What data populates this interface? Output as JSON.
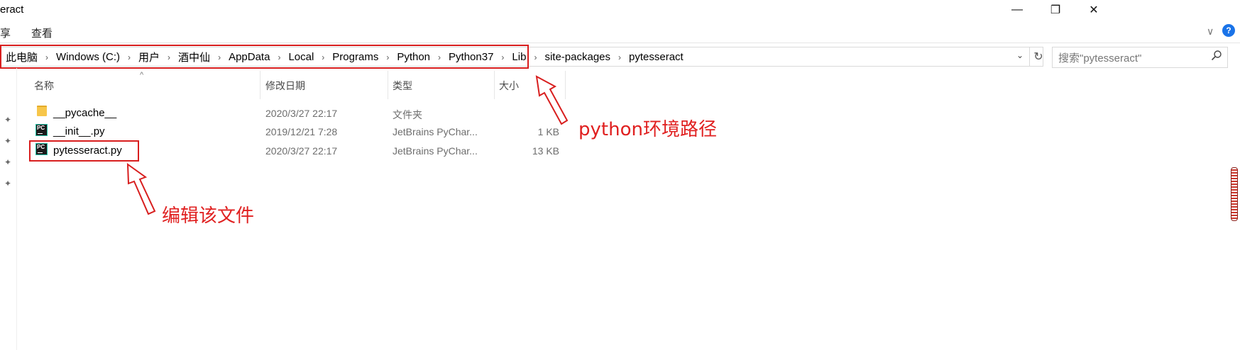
{
  "window": {
    "title": "eract",
    "controls": {
      "minimize": "—",
      "maximize": "❐",
      "close": "✕"
    }
  },
  "ribbon": {
    "tabs": [
      "享",
      "查看"
    ],
    "expand_glyph": "∨",
    "help_glyph": "?"
  },
  "address": {
    "crumbs": [
      "此电脑",
      "Windows (C:)",
      "用户",
      "酒中仙",
      "AppData",
      "Local",
      "Programs",
      "Python",
      "Python37",
      "Lib",
      "site-packages",
      "pytesseract"
    ],
    "separator": "›",
    "dropdown_glyph": "⌄",
    "refresh_glyph": "↻"
  },
  "search": {
    "placeholder": "搜索\"pytesseract\""
  },
  "columns": {
    "name": "名称",
    "date": "修改日期",
    "type": "类型",
    "size": "大小",
    "sort_glyph": "^"
  },
  "files": [
    {
      "name": "__pycache__",
      "date": "2020/3/27 22:17",
      "type": "文件夹",
      "size": "",
      "icon": "folder-icon"
    },
    {
      "name": "__init__.py",
      "date": "2019/12/21 7:28",
      "type": "JetBrains PyChar...",
      "size": "1 KB",
      "icon": "pycharm-file-icon"
    },
    {
      "name": "pytesseract.py",
      "date": "2020/3/27 22:17",
      "type": "JetBrains PyChar...",
      "size": "13 KB",
      "icon": "pycharm-file-icon"
    }
  ],
  "pycharm_icon_text": "PC",
  "pin_glyph": "✦",
  "annotations": {
    "path_label": "python环境路径",
    "file_label": "编辑该文件",
    "color": "#e02020"
  }
}
